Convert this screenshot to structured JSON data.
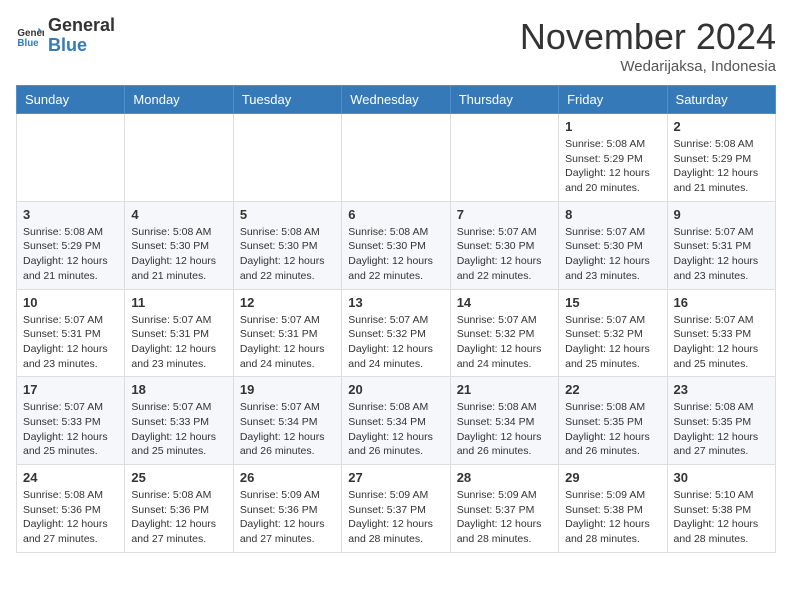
{
  "header": {
    "logo_line1": "General",
    "logo_line2": "Blue",
    "month": "November 2024",
    "location": "Wedarijaksa, Indonesia"
  },
  "weekdays": [
    "Sunday",
    "Monday",
    "Tuesday",
    "Wednesday",
    "Thursday",
    "Friday",
    "Saturday"
  ],
  "weeks": [
    [
      {
        "day": "",
        "info": ""
      },
      {
        "day": "",
        "info": ""
      },
      {
        "day": "",
        "info": ""
      },
      {
        "day": "",
        "info": ""
      },
      {
        "day": "",
        "info": ""
      },
      {
        "day": "1",
        "info": "Sunrise: 5:08 AM\nSunset: 5:29 PM\nDaylight: 12 hours\nand 20 minutes."
      },
      {
        "day": "2",
        "info": "Sunrise: 5:08 AM\nSunset: 5:29 PM\nDaylight: 12 hours\nand 21 minutes."
      }
    ],
    [
      {
        "day": "3",
        "info": "Sunrise: 5:08 AM\nSunset: 5:29 PM\nDaylight: 12 hours\nand 21 minutes."
      },
      {
        "day": "4",
        "info": "Sunrise: 5:08 AM\nSunset: 5:30 PM\nDaylight: 12 hours\nand 21 minutes."
      },
      {
        "day": "5",
        "info": "Sunrise: 5:08 AM\nSunset: 5:30 PM\nDaylight: 12 hours\nand 22 minutes."
      },
      {
        "day": "6",
        "info": "Sunrise: 5:08 AM\nSunset: 5:30 PM\nDaylight: 12 hours\nand 22 minutes."
      },
      {
        "day": "7",
        "info": "Sunrise: 5:07 AM\nSunset: 5:30 PM\nDaylight: 12 hours\nand 22 minutes."
      },
      {
        "day": "8",
        "info": "Sunrise: 5:07 AM\nSunset: 5:30 PM\nDaylight: 12 hours\nand 23 minutes."
      },
      {
        "day": "9",
        "info": "Sunrise: 5:07 AM\nSunset: 5:31 PM\nDaylight: 12 hours\nand 23 minutes."
      }
    ],
    [
      {
        "day": "10",
        "info": "Sunrise: 5:07 AM\nSunset: 5:31 PM\nDaylight: 12 hours\nand 23 minutes."
      },
      {
        "day": "11",
        "info": "Sunrise: 5:07 AM\nSunset: 5:31 PM\nDaylight: 12 hours\nand 23 minutes."
      },
      {
        "day": "12",
        "info": "Sunrise: 5:07 AM\nSunset: 5:31 PM\nDaylight: 12 hours\nand 24 minutes."
      },
      {
        "day": "13",
        "info": "Sunrise: 5:07 AM\nSunset: 5:32 PM\nDaylight: 12 hours\nand 24 minutes."
      },
      {
        "day": "14",
        "info": "Sunrise: 5:07 AM\nSunset: 5:32 PM\nDaylight: 12 hours\nand 24 minutes."
      },
      {
        "day": "15",
        "info": "Sunrise: 5:07 AM\nSunset: 5:32 PM\nDaylight: 12 hours\nand 25 minutes."
      },
      {
        "day": "16",
        "info": "Sunrise: 5:07 AM\nSunset: 5:33 PM\nDaylight: 12 hours\nand 25 minutes."
      }
    ],
    [
      {
        "day": "17",
        "info": "Sunrise: 5:07 AM\nSunset: 5:33 PM\nDaylight: 12 hours\nand 25 minutes."
      },
      {
        "day": "18",
        "info": "Sunrise: 5:07 AM\nSunset: 5:33 PM\nDaylight: 12 hours\nand 25 minutes."
      },
      {
        "day": "19",
        "info": "Sunrise: 5:07 AM\nSunset: 5:34 PM\nDaylight: 12 hours\nand 26 minutes."
      },
      {
        "day": "20",
        "info": "Sunrise: 5:08 AM\nSunset: 5:34 PM\nDaylight: 12 hours\nand 26 minutes."
      },
      {
        "day": "21",
        "info": "Sunrise: 5:08 AM\nSunset: 5:34 PM\nDaylight: 12 hours\nand 26 minutes."
      },
      {
        "day": "22",
        "info": "Sunrise: 5:08 AM\nSunset: 5:35 PM\nDaylight: 12 hours\nand 26 minutes."
      },
      {
        "day": "23",
        "info": "Sunrise: 5:08 AM\nSunset: 5:35 PM\nDaylight: 12 hours\nand 27 minutes."
      }
    ],
    [
      {
        "day": "24",
        "info": "Sunrise: 5:08 AM\nSunset: 5:36 PM\nDaylight: 12 hours\nand 27 minutes."
      },
      {
        "day": "25",
        "info": "Sunrise: 5:08 AM\nSunset: 5:36 PM\nDaylight: 12 hours\nand 27 minutes."
      },
      {
        "day": "26",
        "info": "Sunrise: 5:09 AM\nSunset: 5:36 PM\nDaylight: 12 hours\nand 27 minutes."
      },
      {
        "day": "27",
        "info": "Sunrise: 5:09 AM\nSunset: 5:37 PM\nDaylight: 12 hours\nand 28 minutes."
      },
      {
        "day": "28",
        "info": "Sunrise: 5:09 AM\nSunset: 5:37 PM\nDaylight: 12 hours\nand 28 minutes."
      },
      {
        "day": "29",
        "info": "Sunrise: 5:09 AM\nSunset: 5:38 PM\nDaylight: 12 hours\nand 28 minutes."
      },
      {
        "day": "30",
        "info": "Sunrise: 5:10 AM\nSunset: 5:38 PM\nDaylight: 12 hours\nand 28 minutes."
      }
    ]
  ]
}
